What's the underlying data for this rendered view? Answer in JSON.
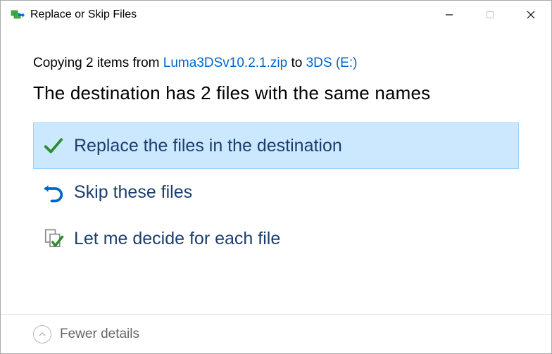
{
  "window": {
    "title": "Replace or Skip Files"
  },
  "copy": {
    "prefix": "Copying 2 items from ",
    "source": "Luma3DSv10.2.1.zip",
    "mid": " to ",
    "dest": "3DS (E:)"
  },
  "headline": "The destination has 2 files with the same names",
  "options": {
    "replace": "Replace the files in the destination",
    "skip": "Skip these files",
    "decide": "Let me decide for each file"
  },
  "footer": {
    "label": "Fewer details"
  }
}
